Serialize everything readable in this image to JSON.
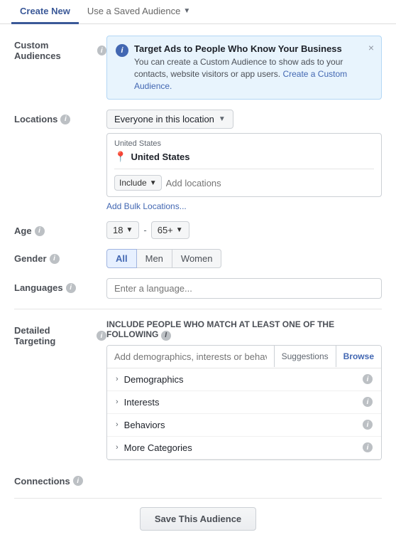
{
  "tabs": {
    "create_new": "Create New",
    "use_saved": "Use a Saved Audience"
  },
  "custom_audiences": {
    "label": "Custom Audiences",
    "info_box": {
      "title": "Target Ads to People Who Know Your Business",
      "body": "You can create a Custom Audience to show ads to your contacts, website visitors or app users.",
      "link_text": "Create a Custom Audience."
    }
  },
  "locations": {
    "label": "Locations",
    "dropdown": "Everyone in this location",
    "country_header": "United States",
    "selected": "United States",
    "include_label": "Include",
    "add_placeholder": "Add locations",
    "add_bulk": "Add Bulk Locations..."
  },
  "age": {
    "label": "Age",
    "from": "18",
    "to": "65+"
  },
  "gender": {
    "label": "Gender",
    "options": [
      "All",
      "Men",
      "Women"
    ],
    "active": "All"
  },
  "languages": {
    "label": "Languages",
    "placeholder": "Enter a language..."
  },
  "detailed_targeting": {
    "label": "Detailed Targeting",
    "description": "INCLUDE people who match at least ONE of the following",
    "search_placeholder": "Add demographics, interests or behaviors",
    "suggestions_label": "Suggestions",
    "browse_label": "Browse",
    "categories": [
      {
        "name": "Demographics"
      },
      {
        "name": "Interests"
      },
      {
        "name": "Behaviors"
      },
      {
        "name": "More Categories"
      }
    ]
  },
  "connections": {
    "label": "Connections"
  },
  "save_button": "Save This Audience",
  "icons": {
    "info": "i",
    "close": "×",
    "arrow_down": "▼",
    "arrow_right": "›",
    "pin": "📍"
  }
}
